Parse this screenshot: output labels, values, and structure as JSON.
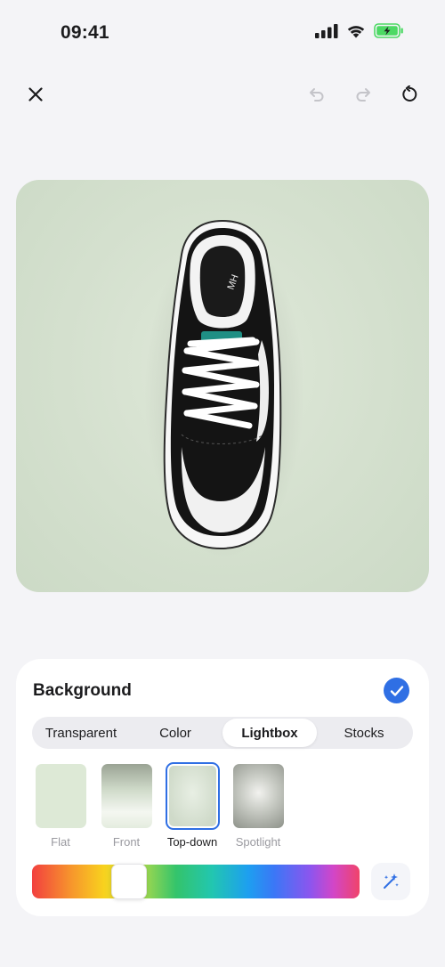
{
  "status_bar": {
    "time": "09:41"
  },
  "panel": {
    "title": "Background",
    "tabs": [
      {
        "label": "Transparent",
        "active": false
      },
      {
        "label": "Color",
        "active": false
      },
      {
        "label": "Lightbox",
        "active": true
      },
      {
        "label": "Stocks",
        "active": false
      }
    ],
    "presets": [
      {
        "label": "Flat",
        "selected": false
      },
      {
        "label": "Front",
        "selected": false
      },
      {
        "label": "Top-down",
        "selected": true
      },
      {
        "label": "Spotlight",
        "selected": false
      }
    ]
  },
  "hue": {
    "value": 0.27
  },
  "colors": {
    "accent": "#2f6fe4",
    "background": "#f4f4f7",
    "preview_background": "#d4e0ce"
  },
  "icons": [
    "cellular-signal-icon",
    "wifi-icon",
    "battery-icon",
    "close-icon",
    "undo-icon",
    "redo-icon",
    "reset-icon",
    "checkmark-icon",
    "magic-wand-icon"
  ]
}
